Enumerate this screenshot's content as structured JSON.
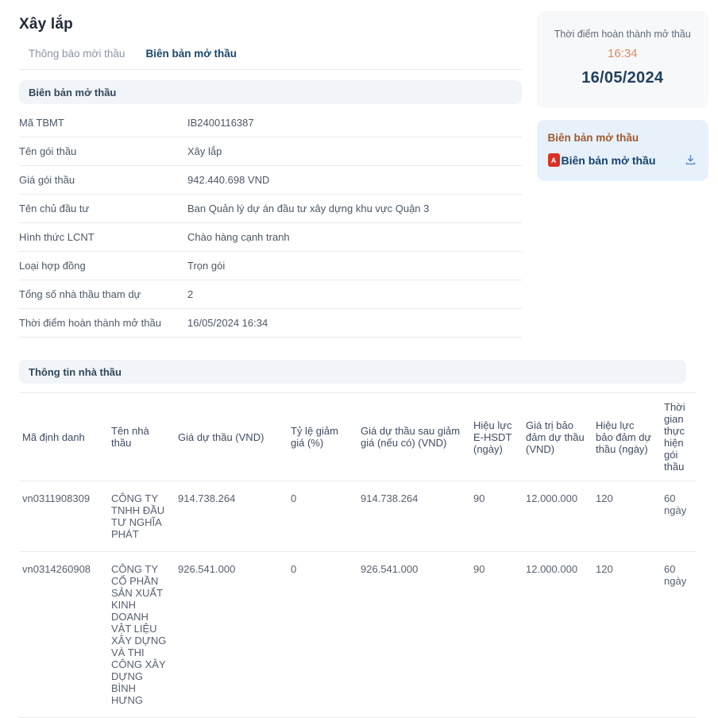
{
  "page": {
    "title": "Xây lắp"
  },
  "tabs": [
    {
      "label": "Thông báo mời thầu",
      "active": false
    },
    {
      "label": "Biên bản mở thầu",
      "active": true
    }
  ],
  "bid_record": {
    "section_title": "Biên bản mở thầu",
    "fields": [
      {
        "label": "Mã TBMT",
        "value": "IB2400116387"
      },
      {
        "label": "Tên gói thầu",
        "value": "Xây lắp"
      },
      {
        "label": "Giá gói thầu",
        "value": "942.440.698 VND"
      },
      {
        "label": "Tên chủ đầu tư",
        "value": "Ban Quản lý dự án đầu tư xây dựng khu vực Quận 3"
      },
      {
        "label": "Hình thức LCNT",
        "value": "Chào hàng cạnh tranh"
      },
      {
        "label": "Loại hợp đồng",
        "value": "Trọn gói"
      },
      {
        "label": "Tổng số nhà thầu tham dự",
        "value": "2"
      },
      {
        "label": "Thời điểm hoàn thành mở thầu",
        "value": "16/05/2024 16:34"
      }
    ]
  },
  "sidebar": {
    "completion_card": {
      "title": "Thời điểm hoàn thành mở thầu",
      "time": "16:34",
      "date": "16/05/2024"
    },
    "document_card": {
      "title": "Biên bản mở thầu",
      "file_label": "Biên bản mở thầu",
      "pdf_icon_glyph": "A",
      "icons": {
        "file": "pdf-file-icon",
        "download": "download-icon"
      }
    }
  },
  "contractors": {
    "section_title": "Thông tin nhà thầu",
    "columns": [
      "Mã định danh",
      "Tên nhà thầu",
      "Giá dự thầu (VND)",
      "Tỷ lệ giảm giá (%)",
      "Giá dự thầu sau giảm giá (nếu có) (VND)",
      "Hiệu lực E-HSDT (ngày)",
      "Giá trị bảo đảm dự thầu (VND)",
      "Hiệu lực bảo đảm dự thầu (ngày)",
      "Thời gian thực hiện gói thầu"
    ],
    "rows": [
      [
        "vn0311908309",
        "CÔNG TY TNHH ĐẦU TƯ NGHĨA PHÁT",
        "914.738.264",
        "0",
        "914.738.264",
        "90",
        "12.000.000",
        "120",
        "60 ngày"
      ],
      [
        "vn0314260908",
        "CÔNG TY CỔ PHẦN SẢN XUẤT KINH DOANH VẬT LIỆU XÂY DỰNG VÀ THI CÔNG XÂY DỰNG BÌNH HƯNG",
        "926.541.000",
        "0",
        "926.541.000",
        "90",
        "12.000.000",
        "120",
        "60 ngày"
      ]
    ]
  },
  "colors": {
    "accent_navy": "#17486f",
    "time_orange": "#dd8a63",
    "doc_title_brown": "#a05a2e",
    "pdf_red": "#d93025",
    "section_bg": "#f1f4f8",
    "card_time_bg": "#f7f8f9",
    "card_doc_bg": "#e7f1fa",
    "border": "#e8eaee"
  }
}
